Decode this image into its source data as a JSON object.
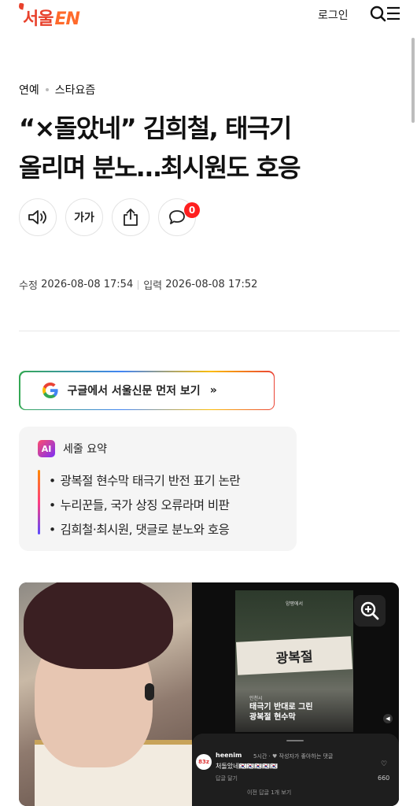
{
  "header": {
    "logo_text": "서울",
    "logo_en": "EN",
    "login_label": "로그인",
    "search_icon": "search-icon",
    "menu_icon": "menu-icon"
  },
  "breadcrumb": [
    "연예",
    "스타요즘"
  ],
  "article": {
    "title_line1": "“×돌았네” 김희철, 태극기",
    "title_line2": "올리며 분노…최시원도 호응",
    "font_size_label": "가가",
    "comment_count": "0",
    "modified_label": "수정",
    "modified_date": "2026-08-08 17:54",
    "published_label": "입력",
    "published_date": "2026-08-08 17:52"
  },
  "tools": [
    "speaker-icon",
    "font-size-button",
    "share-icon",
    "comment-icon"
  ],
  "google_button": {
    "label": "구글에서 서울신문 먼저 보기",
    "arrow": "»",
    "icon": "google-icon"
  },
  "summary": {
    "ai_label": "AI",
    "title": "세줄 요약",
    "items": [
      "광복절 현수막 태극기 반전 표기 논란",
      "누리꾼들, 국가 상징 오류라며 비판",
      "김희철·최시원, 댓글로 분노와 호응"
    ]
  },
  "image": {
    "story_top": "양평에서",
    "banner_text": "광복절",
    "story_caption_small": "인천시",
    "story_caption_line1": "태극기 반대로 그린",
    "story_caption_line2": "광복절 현수막",
    "comment_user": "heenim",
    "comment_meta": "5시간 · ♥ 작성자가 좋아하는 댓글",
    "comment_text": "처돌았네🇰🇷🇰🇷🇰🇷🇰🇷🇰🇷",
    "comment_reply": "답글 달기",
    "comment_more": "이전 답글 1개 보기",
    "comment_likes": "660",
    "avatar_text": "83z"
  },
  "colors": {
    "brand": "#e8412c",
    "badge": "#ff1f1f"
  }
}
